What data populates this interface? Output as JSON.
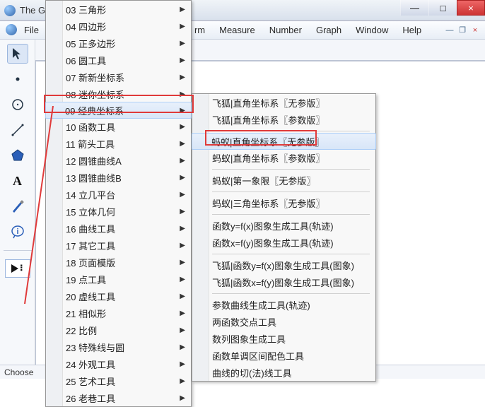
{
  "window": {
    "title": "The G"
  },
  "menubar": {
    "file": "File",
    "transform": "rm",
    "measure": "Measure",
    "number": "Number",
    "graph": "Graph",
    "window": "Window",
    "help": "Help"
  },
  "statusbar": {
    "text": "Choose"
  },
  "main_menu": [
    {
      "label": "03 三角形",
      "arrow": true
    },
    {
      "label": "04 四边形",
      "arrow": true
    },
    {
      "label": "05 正多边形",
      "arrow": true
    },
    {
      "label": "06 圆工具",
      "arrow": true
    },
    {
      "label": "07 新新坐标系",
      "arrow": true
    },
    {
      "label": "08 迷你坐标系",
      "arrow": true
    },
    {
      "label": "09 经典坐标系",
      "arrow": true,
      "hover": true
    },
    {
      "label": "10 函数工具",
      "arrow": true
    },
    {
      "label": "11 箭头工具",
      "arrow": true
    },
    {
      "label": "12 圆锥曲线A",
      "arrow": true
    },
    {
      "label": "13 圆锥曲线B",
      "arrow": true
    },
    {
      "label": "14 立几平台",
      "arrow": true
    },
    {
      "label": "15 立体几何",
      "arrow": true
    },
    {
      "label": "16 曲线工具",
      "arrow": true
    },
    {
      "label": "17 其它工具",
      "arrow": true
    },
    {
      "label": "18 页面模版",
      "arrow": true
    },
    {
      "label": "19 点工具",
      "arrow": true
    },
    {
      "label": "20 虚线工具",
      "arrow": true
    },
    {
      "label": "21 相似形",
      "arrow": true
    },
    {
      "label": "22 比例",
      "arrow": true
    },
    {
      "label": "23 特殊线与圆",
      "arrow": true
    },
    {
      "label": "24 外观工具",
      "arrow": true
    },
    {
      "label": "25 艺术工具",
      "arrow": true
    },
    {
      "label": "26 老巷工具",
      "arrow": true
    }
  ],
  "sub_menu": {
    "group1": [
      "飞狐|直角坐标系〖无参版〗",
      "飞狐|直角坐标系〖参数版〗"
    ],
    "group2": [
      {
        "label": "蚂蚁|直角坐标系〖无参版〗",
        "hover": true
      },
      {
        "label": "蚂蚁|直角坐标系〖参数版〗"
      }
    ],
    "group3": [
      "蚂蚁|第一象限〖无参版〗"
    ],
    "group4": [
      "蚂蚁|三角坐标系〖无参版〗"
    ],
    "group5": [
      "函数y=f(x)图象生成工具(轨迹)",
      "函数x=f(y)图象生成工具(轨迹)"
    ],
    "group6": [
      "飞狐|函数y=f(x)图象生成工具(图象)",
      "飞狐|函数x=f(y)图象生成工具(图象)"
    ],
    "group7": [
      "参数曲线生成工具(轨迹)",
      "两函数交点工具",
      "数列图象生成工具",
      "函数单调区间配色工具",
      "曲线的切(法)线工具"
    ]
  },
  "icons": {
    "min": "—",
    "max": "□",
    "close": "×"
  }
}
